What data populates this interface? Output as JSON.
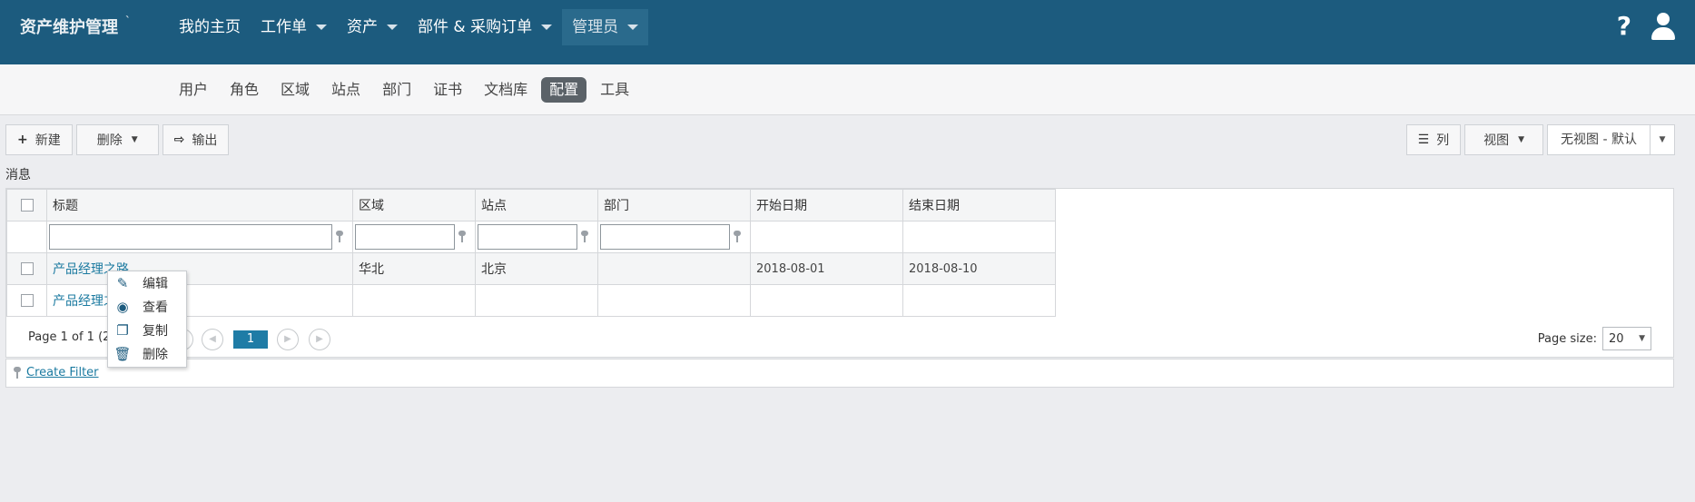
{
  "app": {
    "title": "资产维护管理",
    "title_mark": "`"
  },
  "nav": [
    {
      "label": "我的主页",
      "has_caret": false
    },
    {
      "label": "工作单",
      "has_caret": true
    },
    {
      "label": "资产",
      "has_caret": true
    },
    {
      "label": "部件 & 采购订单",
      "has_caret": true
    },
    {
      "label": "管理员",
      "has_caret": true,
      "active": true
    }
  ],
  "topIcons": {
    "help": "?",
    "user": "user-icon"
  },
  "subnav": [
    {
      "label": "用户"
    },
    {
      "label": "角色"
    },
    {
      "label": "区域"
    },
    {
      "label": "站点"
    },
    {
      "label": "部门"
    },
    {
      "label": "证书"
    },
    {
      "label": "文档库"
    },
    {
      "label": "配置",
      "active": true
    },
    {
      "label": "工具"
    }
  ],
  "toolbar": {
    "new_label": "新建",
    "new_icon": "+",
    "delete_label": "删除",
    "export_label": "输出",
    "export_icon": "⇨",
    "columns_label": "列",
    "columns_icon": "☰",
    "view_label": "视图",
    "view_select": "无视图 - 默认"
  },
  "section_title": "消息",
  "grid": {
    "headers": [
      "标题",
      "区域",
      "站点",
      "部门",
      "开始日期",
      "结束日期"
    ],
    "rows": [
      {
        "title": "产品经理之路",
        "region": "华北",
        "site": "北京",
        "dept": "",
        "start": "2018-08-01",
        "end": "2018-08-10"
      },
      {
        "title": "产品经理之",
        "region": "",
        "site": "",
        "dept": "",
        "start": "",
        "end": ""
      }
    ]
  },
  "pager": {
    "info": "Page 1 of 1 (2",
    "current": "1",
    "size_label": "Page size:",
    "size_value": "20"
  },
  "filter": {
    "create_label": "Create Filter"
  },
  "context_menu": [
    {
      "label": "编辑",
      "icon": "edit-icon"
    },
    {
      "label": "查看",
      "icon": "eye-icon"
    },
    {
      "label": "复制",
      "icon": "copy-icon"
    },
    {
      "label": "删除",
      "icon": "trash-icon"
    }
  ]
}
